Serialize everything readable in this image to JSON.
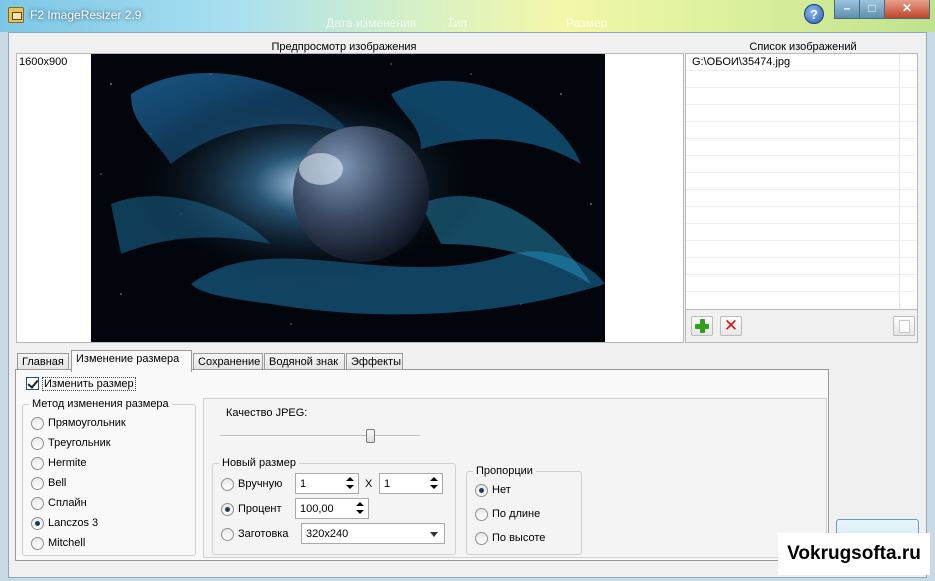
{
  "window": {
    "title": "F2 ImageResizer 2.9",
    "ghost_columns": [
      "Дата изменения",
      "Тип",
      "Размер"
    ],
    "help_label": "?",
    "min_label": "–",
    "max_label": "□",
    "close_label": "✕"
  },
  "preview": {
    "title": "Предпросмотр изображения",
    "resolution": "1600x900"
  },
  "image_list": {
    "title": "Список изображений",
    "items": [
      "G:\\ОБОИ\\35474.jpg"
    ],
    "add_icon": "plus-icon",
    "remove_icon": "delete-icon",
    "remove_label": "✕"
  },
  "tabs": [
    "Главная",
    "Изменение размера",
    "Сохранение",
    "Водяной знак",
    "Эффекты"
  ],
  "active_tab": "Изменение размера",
  "resize": {
    "enable_label": "Изменить размер",
    "enabled": true,
    "method_group_title": "Метод изменения размера",
    "methods": [
      "Прямоугольник",
      "Треугольник",
      "Hermite",
      "Bell",
      "Сплайн",
      "Lanczos 3",
      "Mitchell"
    ],
    "selected_method": "Lanczos 3",
    "jpeg_quality_label": "Качество JPEG:",
    "jpeg_quality_fraction": 0.75,
    "new_size": {
      "title": "Новый размер",
      "manual_label": "Вручную",
      "width_value": "1",
      "x_label": "X",
      "height_value": "1",
      "percent_label": "Процент",
      "percent_value": "100,00",
      "preset_label": "Заготовка",
      "preset_value": "320x240",
      "selected": "Процент"
    },
    "proportions": {
      "title": "Пропорции",
      "options": [
        "Нет",
        "По длине",
        "По высоте"
      ],
      "selected": "Нет"
    }
  },
  "watermark_text": "Vokrugsofta.ru"
}
